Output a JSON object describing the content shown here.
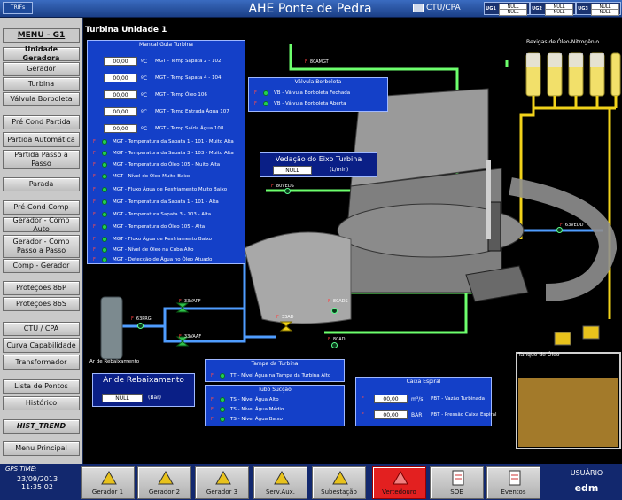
{
  "header": {
    "logo": "TRIFs",
    "title": "AHE Ponte de Pedra",
    "ctu_label": "CTU/CPA",
    "status": [
      {
        "label": "UG1",
        "values": [
          "NULL",
          "NULL"
        ]
      },
      {
        "label": "UG2",
        "values": [
          "NULL",
          "NULL"
        ]
      },
      {
        "label": "UG3",
        "values": [
          "NULL",
          "NULL"
        ]
      }
    ]
  },
  "menu": {
    "title": "MENU - G1",
    "items": [
      {
        "label": "Unidade Geradora",
        "selected": true
      },
      {
        "label": "Gerador"
      },
      {
        "label": "Turbina"
      },
      {
        "label": "Válvula Borboleta"
      },
      {
        "label": "Pré Cond Partida"
      },
      {
        "label": "Partida Automática"
      },
      {
        "label": "Partida Passo a Passo"
      },
      {
        "label": "Parada"
      },
      {
        "label": "Pré-Cond Comp"
      },
      {
        "label": "Gerador - Comp Auto"
      },
      {
        "label": "Gerador - Comp Passo a Passo"
      },
      {
        "label": "Comp - Gerador"
      },
      {
        "label": "Proteções 86P"
      },
      {
        "label": "Proteções 86S"
      },
      {
        "label": "CTU / CPA"
      },
      {
        "label": "Curva Capabilidade"
      },
      {
        "label": "Transformador"
      },
      {
        "label": "Lista de Pontos"
      },
      {
        "label": "Histórico"
      },
      {
        "label": "HIST_TREND"
      },
      {
        "label": "Menu Principal"
      }
    ]
  },
  "screen_title": "Turbina Unidade 1",
  "mancal": {
    "title": "Mancal Guia Turbina",
    "analog": [
      {
        "value": "00,00",
        "unit": "ºC",
        "label": "MGT - Temp Sapata 2 - 102"
      },
      {
        "value": "00,00",
        "unit": "ºC",
        "label": "MGT - Temp Sapata 4 - 104"
      },
      {
        "value": "00,00",
        "unit": "ºC",
        "label": "MGT - Temp Óleo 106"
      },
      {
        "value": "00,00",
        "unit": "ºC",
        "label": "MGT - Temp Entrada Água 107"
      },
      {
        "value": "00,00",
        "unit": "ºC",
        "label": "MGT - Temp Saída Água 108"
      }
    ],
    "alarms": [
      "MGT - Temperatura da Sapata 1 - 101 - Muito Alta",
      "MGT - Temperatura da Sapata 3 - 103 - Muito Alta",
      "MGT - Temperatura do Óleo 105 - Muito Alta",
      "MGT - Nível do Óleo Muito Baixo",
      "MGT - Fluxo Água de Resfriamento Muito Baixo",
      "MGT - Temperatura da Sapata 1 - 101 - Alta",
      "MGT - Temperatura Sapata 3 - 103 - Alta",
      "MGT - Temperatura do Óleo 105 - Alta",
      "MGT - Fluxo Água de Resfriamento Baixo",
      "MGT - Nível de Óleo na Cuba Alto",
      "MGT - Detecção de Água no Óleo Atuado"
    ]
  },
  "valvula": {
    "title": "Válvula Borboleta",
    "items": [
      "VB - Válvula Borboleta Fechada",
      "VB - Válvula Borboleta Aberta"
    ]
  },
  "vedacao": {
    "title": "Vedação do Eixo Turbina",
    "value": "NULL",
    "unit": "(L/min)"
  },
  "rebaixamento": {
    "title": "Ar de Rebaixamento",
    "value": "NULL",
    "unit": "(Bar)",
    "tank_label": "Ar de Rebaixamento"
  },
  "tampa": {
    "title": "Tampa da Turbina",
    "items": [
      "TT - Nível Água na Tampa da Turbina Alto"
    ]
  },
  "succao": {
    "title": "Tubo Sucção",
    "items": [
      "TS - Nível Água Alto",
      "TS - Nível Água Médio",
      "TS - Nível Água Baixo"
    ]
  },
  "caixa": {
    "title": "Caixa Espiral",
    "rows": [
      {
        "value": "00,00",
        "unit": "m³/s",
        "label": "PBT - Vazão Turbinada"
      },
      {
        "value": "00,00",
        "unit": "BAR",
        "label": "PBT - Pressão Caixa Espiral"
      }
    ]
  },
  "diagram": {
    "tags": [
      "80AMGT",
      "80VEDS",
      "63PRG",
      "33VAPF",
      "33VAAF",
      "33AD",
      "80ADS",
      "80ADI",
      "63VEDD"
    ],
    "bexigas_label": "Bexigas de Óleo-Nitrogênio",
    "tanque_label": "Tanque de Óleo"
  },
  "footer": {
    "gps_label": "GPS TIME:",
    "date": "23/09/2013",
    "time": "11:35:02",
    "nav": [
      "Gerador 1",
      "Gerador 2",
      "Gerador 3",
      "Serv.Aux.",
      "Subestação",
      "Vertedouro",
      "SOE",
      "Eventos"
    ],
    "user_label": "USUÁRIO",
    "user": "edm"
  }
}
